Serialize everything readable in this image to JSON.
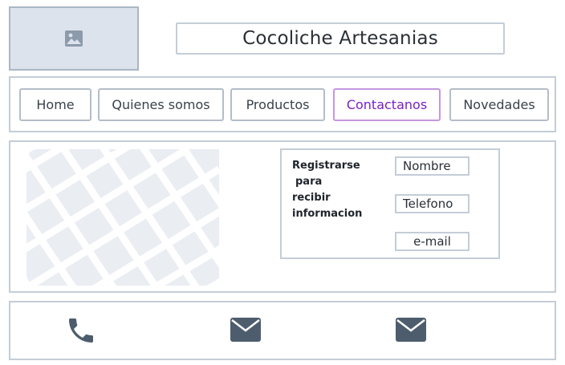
{
  "header": {
    "logo_icon": "image-placeholder-icon",
    "title": "Cocoliche Artesanias"
  },
  "nav": {
    "items": [
      {
        "label": "Home"
      },
      {
        "label": "Quienes somos"
      },
      {
        "label": "Productos"
      },
      {
        "label": "Contactanos",
        "active": true
      },
      {
        "label": "Novedades"
      }
    ]
  },
  "contact": {
    "map_icon": "map-placeholder",
    "form": {
      "label_lines": [
        "Registrarse",
        "para",
        "recibir",
        "informacion"
      ],
      "fields": [
        {
          "value": "Nombre"
        },
        {
          "value": "Telefono"
        },
        {
          "value": "e-mail"
        }
      ]
    }
  },
  "footer": {
    "icons": [
      "phone-icon",
      "envelope-icon",
      "envelope-icon"
    ]
  },
  "colors": {
    "border": "#c4cdd7",
    "active_border": "#c596e0",
    "active_text": "#7a20c4",
    "icon_fill": "#4d5d6d",
    "map_background": "#eaedf2"
  }
}
